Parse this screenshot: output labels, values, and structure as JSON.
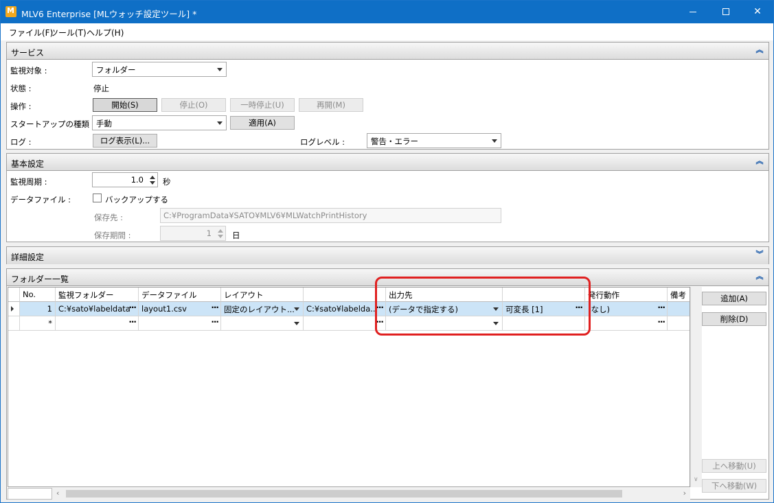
{
  "window": {
    "title": "MLV6 Enterprise [MLウォッチ設定ツール] *"
  },
  "menu": {
    "items": [
      "ファイル(F)",
      "ツール(T)",
      "ヘルプ(H)"
    ]
  },
  "service": {
    "header": "サービス",
    "monitor_target_label": "監視対象 :",
    "monitor_target_value": "フォルダー",
    "state_label": "状態 :",
    "state_value": "停止",
    "operation_label": "操作 :",
    "btn_start": "開始(S)",
    "btn_stop": "停止(O)",
    "btn_pause": "一時停止(U)",
    "btn_resume": "再開(M)",
    "startup_label": "スタートアップの種類 :",
    "startup_value": "手動",
    "btn_apply": "適用(A)",
    "log_label": "ログ :",
    "btn_log_view": "ログ表示(L)...",
    "log_level_label": "ログレベル :",
    "log_level_value": "警告・エラー"
  },
  "basic": {
    "header": "基本設定",
    "interval_label": "監視周期 :",
    "interval_value": "1.0",
    "interval_unit": "秒",
    "datafile_label": "データファイル :",
    "backup_label": "バックアップする",
    "save_dest_label": "保存先 :",
    "save_dest_value": "C:¥ProgramData¥SATO¥MLV6¥MLWatchPrintHistory",
    "save_period_label": "保存期間 :",
    "save_period_value": "1",
    "save_period_unit": "日"
  },
  "detail": {
    "header": "詳細設定"
  },
  "folders": {
    "header": "フォルダー一覧",
    "columns": [
      "No.",
      "監視フォルダー",
      "データファイル",
      "レイアウト",
      "",
      "出力先",
      "",
      "発行動作",
      "備考"
    ],
    "rows": [
      {
        "no": "1",
        "folder": "C:¥sato¥labeldata",
        "datafile": "layout1.csv",
        "layout": "固定のレイアウト...",
        "layout_path": "C:¥sato¥labelda...",
        "output": "(データで指定する)",
        "output_extra": "可変長 [1]",
        "action": "(なし)",
        "note": ""
      }
    ],
    "new_row_marker": "*",
    "btn_add": "追加(A)",
    "btn_delete": "削除(D)",
    "btn_up": "上へ移動(U)",
    "btn_down": "下へ移動(W)"
  }
}
